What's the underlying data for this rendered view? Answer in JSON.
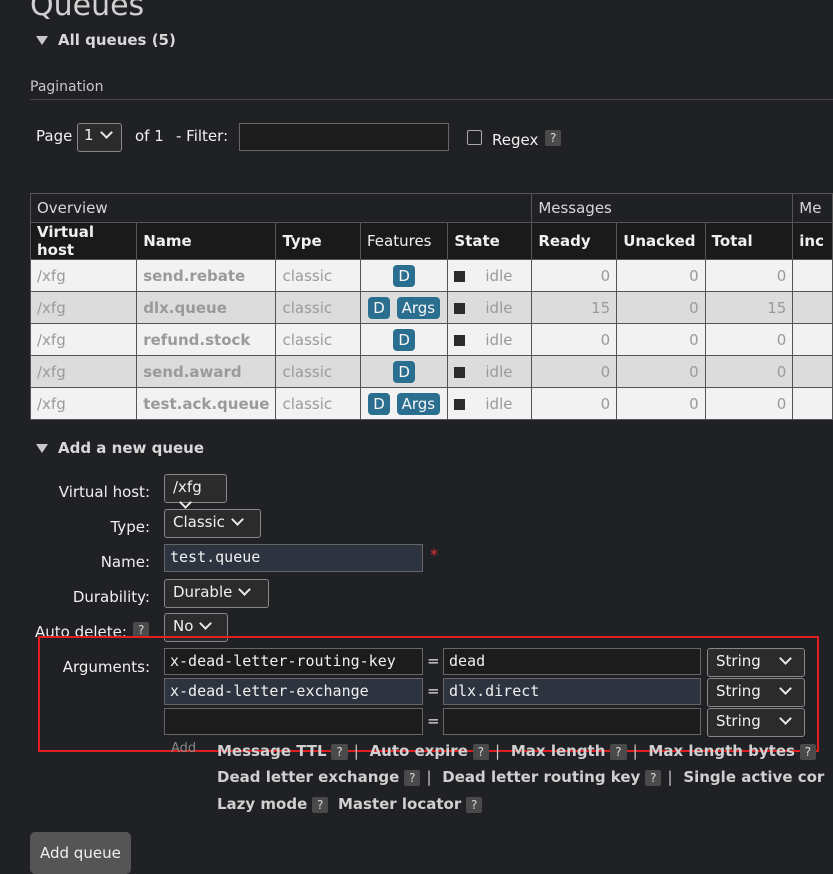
{
  "page_title": "Queues",
  "all_queues": {
    "label": "All queues (5)"
  },
  "pagination": {
    "label": "Pagination",
    "page_label": "Page",
    "page_value": "1",
    "of_label": "of 1",
    "filter_label": "- Filter:",
    "filter_value": "",
    "regex_label": "Regex",
    "help": "?"
  },
  "table": {
    "groups": {
      "overview": "Overview",
      "messages": "Messages",
      "more": "Me"
    },
    "headers": [
      "Virtual host",
      "Name",
      "Type",
      "Features",
      "State",
      "Ready",
      "Unacked",
      "Total",
      "inc"
    ],
    "rows": [
      {
        "vhost": "/xfg",
        "name": "send.rebate",
        "type": "classic",
        "features": [
          "D"
        ],
        "state": "idle",
        "ready": "0",
        "unacked": "0",
        "total": "0",
        "faint": true
      },
      {
        "vhost": "/xfg",
        "name": "dlx.queue",
        "type": "classic",
        "features": [
          "D",
          "Args"
        ],
        "state": "idle",
        "ready": "15",
        "unacked": "0",
        "total": "15",
        "faint": false
      },
      {
        "vhost": "/xfg",
        "name": "refund.stock",
        "type": "classic",
        "features": [
          "D"
        ],
        "state": "idle",
        "ready": "0",
        "unacked": "0",
        "total": "0",
        "faint": true
      },
      {
        "vhost": "/xfg",
        "name": "send.award",
        "type": "classic",
        "features": [
          "D"
        ],
        "state": "idle",
        "ready": "0",
        "unacked": "0",
        "total": "0",
        "faint": false
      },
      {
        "vhost": "/xfg",
        "name": "test.ack.queue",
        "type": "classic",
        "features": [
          "D",
          "Args"
        ],
        "state": "idle",
        "ready": "0",
        "unacked": "0",
        "total": "0",
        "faint": true
      }
    ]
  },
  "add_queue": {
    "label": "Add a new queue",
    "virtual_host_label": "Virtual host:",
    "virtual_host_value": "/xfg",
    "type_label": "Type:",
    "type_value": "Classic",
    "name_label": "Name:",
    "name_value": "test.queue",
    "required_mark": "*",
    "durability_label": "Durability:",
    "durability_value": "Durable",
    "auto_delete_label": "Auto delete:",
    "auto_delete_help": "?",
    "auto_delete_value": "No",
    "arguments_label": "Arguments:",
    "arguments": [
      {
        "key": "x-dead-letter-routing-key",
        "eq": "=",
        "value": "dead",
        "type": "String"
      },
      {
        "key": "x-dead-letter-exchange",
        "eq": "=",
        "value": "dlx.direct",
        "type": "String"
      },
      {
        "key": "",
        "eq": "=",
        "value": "",
        "type": "String"
      }
    ],
    "add_label": "Add",
    "hints_row1": [
      "Message TTL",
      "Auto expire",
      "Max length",
      "Max length bytes"
    ],
    "hints_row2": [
      "Dead letter exchange",
      "Dead letter routing key",
      "Single active cor"
    ],
    "hints_row3": [
      "Lazy mode",
      "Master locator"
    ],
    "help": "?",
    "sep": "|",
    "submit": "Add queue"
  }
}
